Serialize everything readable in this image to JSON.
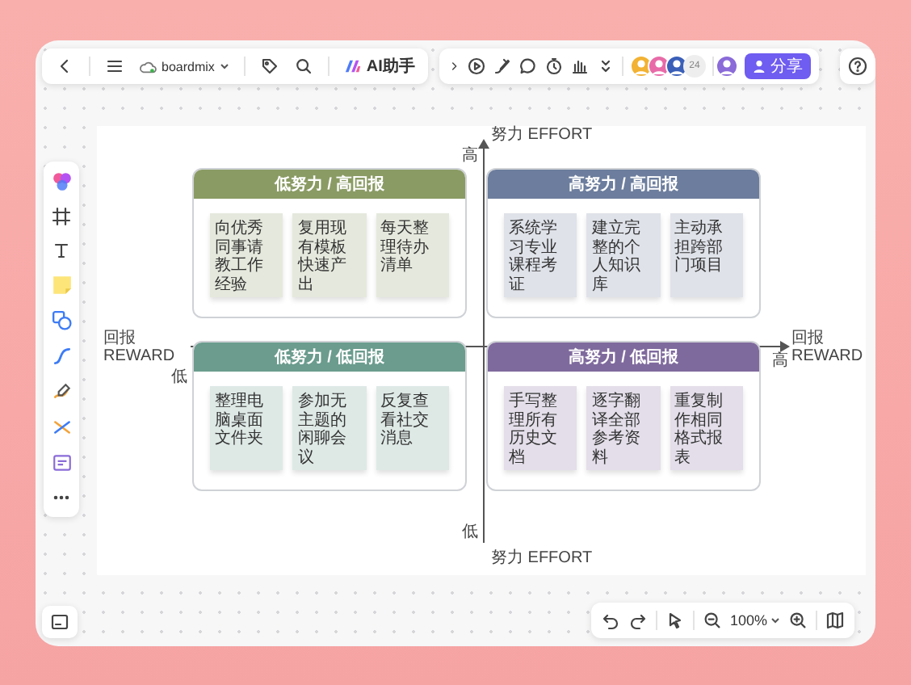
{
  "toolbar_left": {
    "app_name": "boardmix",
    "ai_button": "AI助手"
  },
  "toolbar_right": {
    "collaborator_count": "24",
    "share_button": "分享"
  },
  "axes": {
    "y_label_top": "努力 EFFORT",
    "y_high": "高",
    "x_label_left": "回报 REWARD",
    "x_low": "低",
    "x_label_right": "回报 REWARD",
    "x_high": "高",
    "y_low": "低",
    "y_label_bottom": "努力 EFFORT"
  },
  "quadrants": [
    {
      "title": "低努力 / 高回报",
      "color": "#8a9b64",
      "notes": [
        "向优秀同事请教工作经验",
        "复用现有模板快速产出",
        "每天整理待办清单"
      ]
    },
    {
      "title": "高努力 / 高回报",
      "color": "#6c7d9d",
      "notes": [
        "系统学习专业课程考证",
        "建立完整的个人知识库",
        "主动承担跨部门项目"
      ]
    },
    {
      "title": "低努力 / 低回报",
      "color": "#6b9c8e",
      "notes": [
        "整理电脑桌面文件夹",
        "参加无主题的闲聊会议",
        "反复查看社交消息"
      ]
    },
    {
      "title": "高努力 / 低回报",
      "color": "#7f6a9d",
      "notes": [
        "手写整理所有历史文档",
        "逐字翻译全部参考资料",
        "重复制作相同格式报表"
      ]
    }
  ],
  "zoom_level": "100%"
}
